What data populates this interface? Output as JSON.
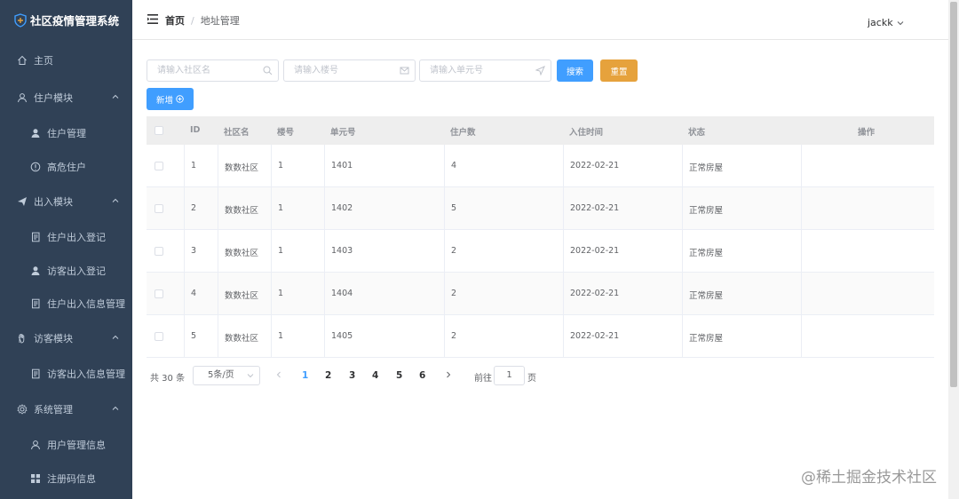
{
  "app": {
    "title": "社区疫情管理系统"
  },
  "sidebar": {
    "items": [
      {
        "label": "主页",
        "icon": "home-icon",
        "level": "top"
      },
      {
        "label": "住户模块",
        "icon": "user-icon",
        "level": "top",
        "expanded": true
      },
      {
        "label": "住户管理",
        "icon": "person-filled-icon",
        "level": "sub"
      },
      {
        "label": "高危住户",
        "icon": "warning-circle-icon",
        "level": "sub"
      },
      {
        "label": "出入模块",
        "icon": "send-icon",
        "level": "top",
        "expanded": true
      },
      {
        "label": "住户出入登记",
        "icon": "document-icon",
        "level": "sub"
      },
      {
        "label": "访客出入登记",
        "icon": "person-filled-icon",
        "level": "sub"
      },
      {
        "label": "住户出入信息管理",
        "icon": "document-icon",
        "level": "sub"
      },
      {
        "label": "访客模块",
        "icon": "hand-icon",
        "level": "top",
        "expanded": true
      },
      {
        "label": "访客出入信息管理",
        "icon": "document-icon",
        "level": "sub"
      },
      {
        "label": "系统管理",
        "icon": "gear-icon",
        "level": "top",
        "expanded": true
      },
      {
        "label": "用户管理信息",
        "icon": "user-icon",
        "level": "sub"
      },
      {
        "label": "注册码信息",
        "icon": "grid-icon",
        "level": "sub"
      }
    ]
  },
  "header": {
    "breadcrumb": {
      "home": "首页",
      "separator": "/",
      "current": "地址管理"
    },
    "user": "jackk"
  },
  "search": {
    "community_placeholder": "请输入社区名",
    "building_placeholder": "请输入楼号",
    "unit_placeholder": "请输入单元号",
    "search_label": "搜索",
    "reset_label": "重置",
    "add_label": "新增"
  },
  "table": {
    "headers": [
      "ID",
      "社区名",
      "楼号",
      "单元号",
      "住户数",
      "入住时间",
      "状态",
      "操作"
    ],
    "rows": [
      {
        "id": "1",
        "community": "数数社区",
        "building": "1",
        "unit": "1401",
        "households": "4",
        "date": "2022-02-21",
        "status": "正常房屋"
      },
      {
        "id": "2",
        "community": "数数社区",
        "building": "1",
        "unit": "1402",
        "households": "5",
        "date": "2022-02-21",
        "status": "正常房屋"
      },
      {
        "id": "3",
        "community": "数数社区",
        "building": "1",
        "unit": "1403",
        "households": "2",
        "date": "2022-02-21",
        "status": "正常房屋"
      },
      {
        "id": "4",
        "community": "数数社区",
        "building": "1",
        "unit": "1404",
        "households": "2",
        "date": "2022-02-21",
        "status": "正常房屋"
      },
      {
        "id": "5",
        "community": "数数社区",
        "building": "1",
        "unit": "1405",
        "households": "2",
        "date": "2022-02-21",
        "status": "正常房屋"
      }
    ]
  },
  "pagination": {
    "total": "共 30 条",
    "page_size": "5条/页",
    "pages": [
      "1",
      "2",
      "3",
      "4",
      "5",
      "6"
    ],
    "current": "1",
    "goto_label": "前往",
    "goto_value": "1",
    "unit_label": "页"
  },
  "watermark": "@稀土掘金技术社区",
  "colors": {
    "sidebar": "#304156",
    "primary": "#409eff",
    "warning": "#e6a23c"
  }
}
